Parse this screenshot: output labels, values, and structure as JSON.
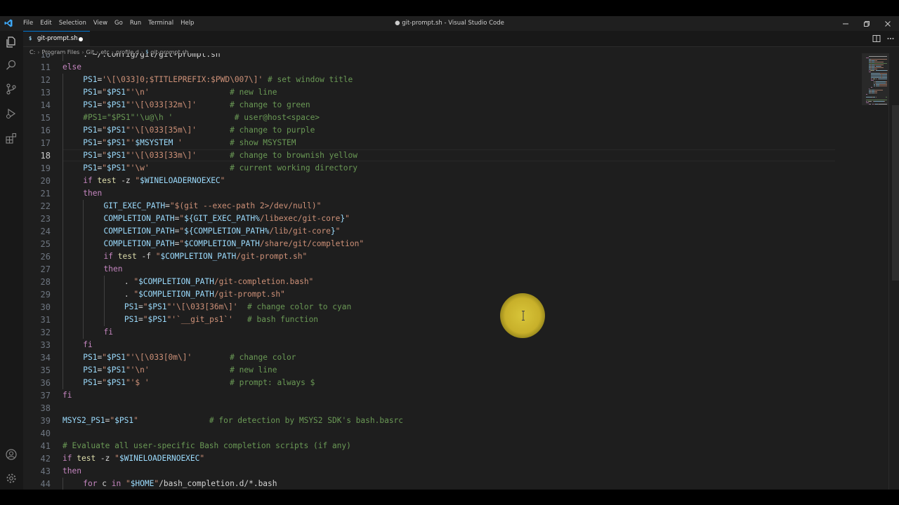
{
  "menu": [
    "File",
    "Edit",
    "Selection",
    "View",
    "Go",
    "Run",
    "Terminal",
    "Help"
  ],
  "window_title": "● git-prompt.sh - Visual Studio Code",
  "tab": {
    "label": "git-prompt.sh"
  },
  "breadcrumb": [
    "C:",
    "Program Files",
    "Git",
    "etc",
    "profile.d",
    "git-prompt.sh"
  ],
  "editor": {
    "current_line": 18,
    "lines": [
      {
        "n": "10",
        "indent": 4,
        "tokens": [
          [
            "op",
            ". "
          ],
          [
            "op",
            "~/.config/git/git-prompt.sh"
          ]
        ]
      },
      {
        "n": "11",
        "indent": 0,
        "tokens": [
          [
            "ctrl",
            "else"
          ]
        ]
      },
      {
        "n": "12",
        "indent": 4,
        "tokens": [
          [
            "var",
            "PS1"
          ],
          [
            "op",
            "="
          ],
          [
            "str",
            "'\\[\\033]0;$TITLEPREFIX:$PWD\\007\\]'"
          ],
          [
            "cmt",
            " # set window title"
          ]
        ]
      },
      {
        "n": "13",
        "indent": 4,
        "tokens": [
          [
            "var",
            "PS1"
          ],
          [
            "op",
            "="
          ],
          [
            "str",
            "\""
          ],
          [
            "var",
            "$PS1"
          ],
          [
            "str",
            "\"'\\n'"
          ],
          [
            "op",
            "                 "
          ],
          [
            "cmt",
            "# new line"
          ]
        ]
      },
      {
        "n": "14",
        "indent": 4,
        "tokens": [
          [
            "var",
            "PS1"
          ],
          [
            "op",
            "="
          ],
          [
            "str",
            "\""
          ],
          [
            "var",
            "$PS1"
          ],
          [
            "str",
            "\"'\\[\\033[32m\\]'"
          ],
          [
            "op",
            "       "
          ],
          [
            "cmt",
            "# change to green"
          ]
        ]
      },
      {
        "n": "15",
        "indent": 4,
        "tokens": [
          [
            "cmt",
            "#PS1=\"$PS1\"'\\u@\\h '             # user@host<space>"
          ]
        ]
      },
      {
        "n": "16",
        "indent": 4,
        "tokens": [
          [
            "var",
            "PS1"
          ],
          [
            "op",
            "="
          ],
          [
            "str",
            "\""
          ],
          [
            "var",
            "$PS1"
          ],
          [
            "str",
            "\"'\\[\\033[35m\\]'"
          ],
          [
            "op",
            "       "
          ],
          [
            "cmt",
            "# change to purple"
          ]
        ]
      },
      {
        "n": "17",
        "indent": 4,
        "tokens": [
          [
            "var",
            "PS1"
          ],
          [
            "op",
            "="
          ],
          [
            "str",
            "\""
          ],
          [
            "var",
            "$PS1"
          ],
          [
            "str",
            "\"'"
          ],
          [
            "var",
            "$MSYSTEM"
          ],
          [
            "str",
            " '"
          ],
          [
            "op",
            "          "
          ],
          [
            "cmt",
            "# show MSYSTEM"
          ]
        ]
      },
      {
        "n": "18",
        "indent": 4,
        "tokens": [
          [
            "var",
            "PS1"
          ],
          [
            "op",
            "="
          ],
          [
            "str",
            "\""
          ],
          [
            "var",
            "$PS1"
          ],
          [
            "str",
            "\"'\\[\\033[33m\\]'"
          ],
          [
            "op",
            "       "
          ],
          [
            "cmt",
            "# change to brownish yellow"
          ]
        ]
      },
      {
        "n": "19",
        "indent": 4,
        "tokens": [
          [
            "var",
            "PS1"
          ],
          [
            "op",
            "="
          ],
          [
            "str",
            "\""
          ],
          [
            "var",
            "$PS1"
          ],
          [
            "str",
            "\"'\\w'"
          ],
          [
            "op",
            "                 "
          ],
          [
            "cmt",
            "# current working directory"
          ]
        ]
      },
      {
        "n": "20",
        "indent": 4,
        "tokens": [
          [
            "ctrl",
            "if"
          ],
          [
            "op",
            " "
          ],
          [
            "kw",
            "test"
          ],
          [
            "op",
            " -z "
          ],
          [
            "str",
            "\""
          ],
          [
            "var",
            "$WINELOADERNOEXEC"
          ],
          [
            "str",
            "\""
          ]
        ]
      },
      {
        "n": "21",
        "indent": 4,
        "tokens": [
          [
            "ctrl",
            "then"
          ]
        ]
      },
      {
        "n": "22",
        "indent": 8,
        "tokens": [
          [
            "var",
            "GIT_EXEC_PATH"
          ],
          [
            "op",
            "="
          ],
          [
            "str",
            "\"$(git --exec-path 2>/dev/null)\""
          ]
        ]
      },
      {
        "n": "23",
        "indent": 8,
        "tokens": [
          [
            "var",
            "COMPLETION_PATH"
          ],
          [
            "op",
            "="
          ],
          [
            "str",
            "\""
          ],
          [
            "var",
            "${GIT_EXEC_PATH%"
          ],
          [
            "str",
            "/libexec/git-core"
          ],
          [
            "var",
            "}"
          ],
          [
            "str",
            "\""
          ]
        ]
      },
      {
        "n": "24",
        "indent": 8,
        "tokens": [
          [
            "var",
            "COMPLETION_PATH"
          ],
          [
            "op",
            "="
          ],
          [
            "str",
            "\""
          ],
          [
            "var",
            "${COMPLETION_PATH%"
          ],
          [
            "str",
            "/lib/git-core"
          ],
          [
            "var",
            "}"
          ],
          [
            "str",
            "\""
          ]
        ]
      },
      {
        "n": "25",
        "indent": 8,
        "tokens": [
          [
            "var",
            "COMPLETION_PATH"
          ],
          [
            "op",
            "="
          ],
          [
            "str",
            "\""
          ],
          [
            "var",
            "$COMPLETION_PATH"
          ],
          [
            "str",
            "/share/git/completion\""
          ]
        ]
      },
      {
        "n": "26",
        "indent": 8,
        "tokens": [
          [
            "ctrl",
            "if"
          ],
          [
            "op",
            " "
          ],
          [
            "kw",
            "test"
          ],
          [
            "op",
            " -f "
          ],
          [
            "str",
            "\""
          ],
          [
            "var",
            "$COMPLETION_PATH"
          ],
          [
            "str",
            "/git-prompt.sh\""
          ]
        ]
      },
      {
        "n": "27",
        "indent": 8,
        "tokens": [
          [
            "ctrl",
            "then"
          ]
        ]
      },
      {
        "n": "28",
        "indent": 12,
        "tokens": [
          [
            "op",
            ". "
          ],
          [
            "str",
            "\""
          ],
          [
            "var",
            "$COMPLETION_PATH"
          ],
          [
            "str",
            "/git-completion.bash\""
          ]
        ]
      },
      {
        "n": "29",
        "indent": 12,
        "tokens": [
          [
            "op",
            ". "
          ],
          [
            "str",
            "\""
          ],
          [
            "var",
            "$COMPLETION_PATH"
          ],
          [
            "str",
            "/git-prompt.sh\""
          ]
        ]
      },
      {
        "n": "30",
        "indent": 12,
        "tokens": [
          [
            "var",
            "PS1"
          ],
          [
            "op",
            "="
          ],
          [
            "str",
            "\""
          ],
          [
            "var",
            "$PS1"
          ],
          [
            "str",
            "\"'\\[\\033[36m\\]'"
          ],
          [
            "op",
            "  "
          ],
          [
            "cmt",
            "# change color to cyan"
          ]
        ]
      },
      {
        "n": "31",
        "indent": 12,
        "tokens": [
          [
            "var",
            "PS1"
          ],
          [
            "op",
            "="
          ],
          [
            "str",
            "\""
          ],
          [
            "var",
            "$PS1"
          ],
          [
            "str",
            "\"'`__git_ps1`'"
          ],
          [
            "op",
            "   "
          ],
          [
            "cmt",
            "# bash function"
          ]
        ]
      },
      {
        "n": "32",
        "indent": 8,
        "tokens": [
          [
            "ctrl",
            "fi"
          ]
        ]
      },
      {
        "n": "33",
        "indent": 4,
        "tokens": [
          [
            "ctrl",
            "fi"
          ]
        ]
      },
      {
        "n": "34",
        "indent": 4,
        "tokens": [
          [
            "var",
            "PS1"
          ],
          [
            "op",
            "="
          ],
          [
            "str",
            "\""
          ],
          [
            "var",
            "$PS1"
          ],
          [
            "str",
            "\"'\\[\\033[0m\\]'"
          ],
          [
            "op",
            "        "
          ],
          [
            "cmt",
            "# change color"
          ]
        ]
      },
      {
        "n": "35",
        "indent": 4,
        "tokens": [
          [
            "var",
            "PS1"
          ],
          [
            "op",
            "="
          ],
          [
            "str",
            "\""
          ],
          [
            "var",
            "$PS1"
          ],
          [
            "str",
            "\"'\\n'"
          ],
          [
            "op",
            "                 "
          ],
          [
            "cmt",
            "# new line"
          ]
        ]
      },
      {
        "n": "36",
        "indent": 4,
        "tokens": [
          [
            "var",
            "PS1"
          ],
          [
            "op",
            "="
          ],
          [
            "str",
            "\""
          ],
          [
            "var",
            "$PS1"
          ],
          [
            "str",
            "\"'$ '"
          ],
          [
            "op",
            "                 "
          ],
          [
            "cmt",
            "# prompt: always $"
          ]
        ]
      },
      {
        "n": "37",
        "indent": 0,
        "tokens": [
          [
            "ctrl",
            "fi"
          ]
        ]
      },
      {
        "n": "38",
        "indent": 0,
        "tokens": []
      },
      {
        "n": "39",
        "indent": 0,
        "tokens": [
          [
            "var",
            "MSYS2_PS1"
          ],
          [
            "op",
            "="
          ],
          [
            "str",
            "\""
          ],
          [
            "var",
            "$PS1"
          ],
          [
            "str",
            "\""
          ],
          [
            "op",
            "               "
          ],
          [
            "cmt",
            "# for detection by MSYS2 SDK's bash.basrc"
          ]
        ]
      },
      {
        "n": "40",
        "indent": 0,
        "tokens": []
      },
      {
        "n": "41",
        "indent": 0,
        "tokens": [
          [
            "cmt",
            "# Evaluate all user-specific Bash completion scripts (if any)"
          ]
        ]
      },
      {
        "n": "42",
        "indent": 0,
        "tokens": [
          [
            "ctrl",
            "if"
          ],
          [
            "op",
            " "
          ],
          [
            "kw",
            "test"
          ],
          [
            "op",
            " -z "
          ],
          [
            "str",
            "\""
          ],
          [
            "var",
            "$WINELOADERNOEXEC"
          ],
          [
            "str",
            "\""
          ]
        ]
      },
      {
        "n": "43",
        "indent": 0,
        "tokens": [
          [
            "ctrl",
            "then"
          ]
        ]
      },
      {
        "n": "44",
        "indent": 4,
        "tokens": [
          [
            "ctrl",
            "for"
          ],
          [
            "op",
            " c "
          ],
          [
            "ctrl",
            "in"
          ],
          [
            "op",
            " "
          ],
          [
            "str",
            "\""
          ],
          [
            "var",
            "$HOME"
          ],
          [
            "str",
            "\""
          ],
          [
            "op",
            "/bash_completion.d/*.bash"
          ]
        ]
      }
    ]
  },
  "colors": {
    "keyword": "#c586c0",
    "builtin": "#dcdcaa",
    "string": "#ce9178",
    "variable": "#9cdcfe",
    "comment": "#6a9955",
    "accent": "#0078d4"
  }
}
